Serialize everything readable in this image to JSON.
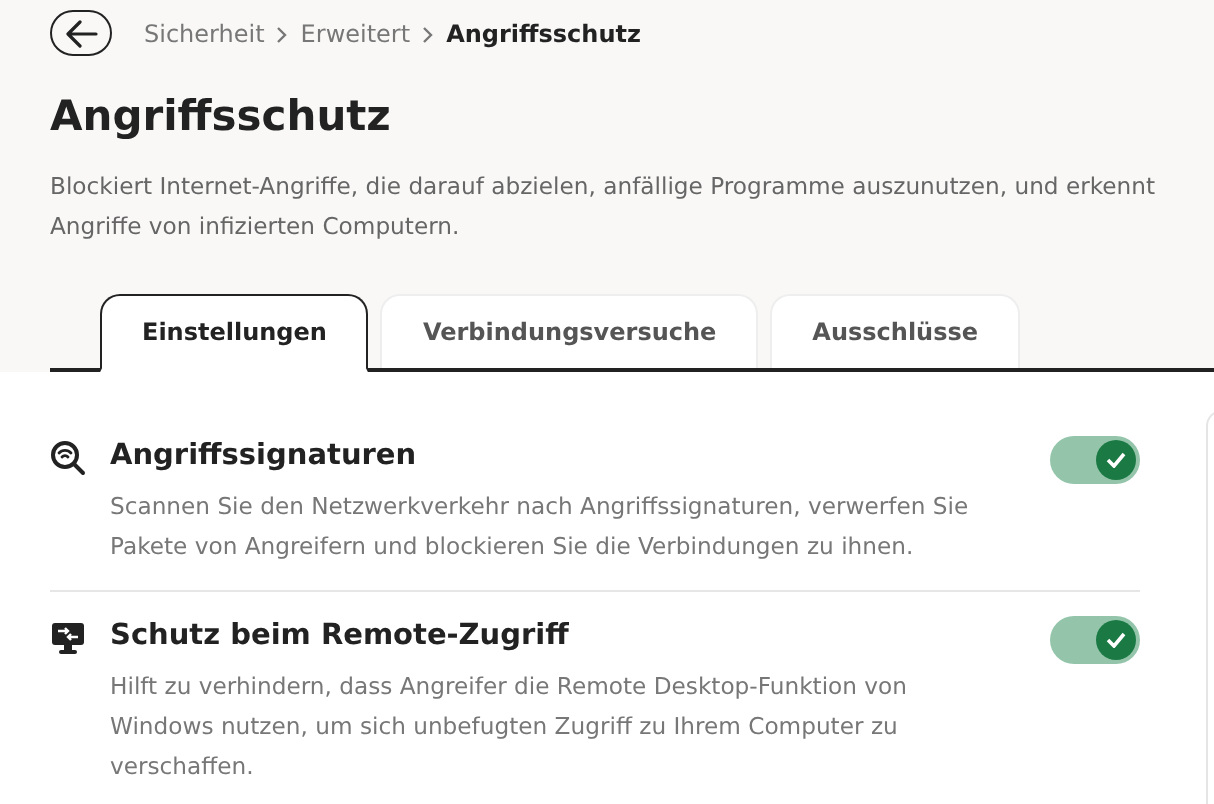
{
  "breadcrumb": [
    "Sicherheit",
    "Erweitert",
    "Angriffsschutz"
  ],
  "title": "Angriffsschutz",
  "description": "Blockiert Internet-Angriffe, die darauf abzielen, anfällige Programme auszunutzen, und erkennt Angriffe von infizierten Computern.",
  "tabs": [
    {
      "label": "Einstellungen",
      "selected": true
    },
    {
      "label": "Verbindungsversuche",
      "selected": false
    },
    {
      "label": "Ausschlüsse",
      "selected": false
    }
  ],
  "settings": [
    {
      "kind": "signatures",
      "title": "Angriffssignaturen",
      "description": "Scannen Sie den Netzwerkverkehr nach Angriffssignaturen, verwerfen Sie Pakete von Angreifern und blockieren Sie die Verbindungen zu ihnen.",
      "on": true
    },
    {
      "kind": "remote",
      "title": "Schutz beim Remote-Zugriff",
      "description": "Hilft zu verhindern, dass Angreifer die Remote Desktop-Funktion von Windows nutzen, um sich unbefugten Zugriff zu Ihrem Computer zu verschaffen.",
      "on": true
    }
  ]
}
